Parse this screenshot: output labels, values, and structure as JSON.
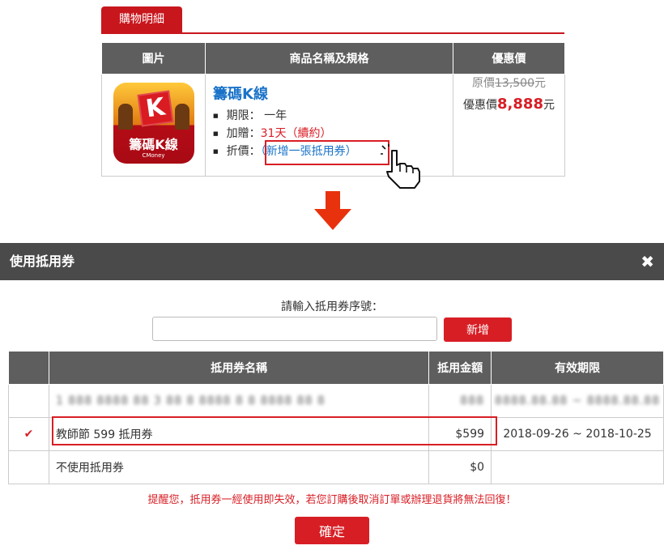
{
  "cart": {
    "tab_label": "購物明細",
    "headers": {
      "image": "圖片",
      "name": "商品名稱及規格",
      "price": "優惠價"
    },
    "product": {
      "icon_name": "籌碼K線",
      "icon_letter": "K",
      "icon_brand": "CMoney",
      "name": "籌碼K線",
      "spec_period_label": "期限：",
      "spec_period_value": "一年",
      "spec_bonus_label": "加贈：",
      "spec_bonus_value": "31天",
      "spec_bonus_link": "（續約）",
      "spec_discount_label": "折價：",
      "spec_discount_link": "（新增一張抵用券）",
      "orig_label": "原價",
      "orig_value": "13,500",
      "orig_unit": "元",
      "sale_label": "優惠價",
      "sale_value": "8,888",
      "sale_unit": "元"
    }
  },
  "modal": {
    "title": "使用抵用券",
    "close_icon": "close-icon",
    "prompt": "請輸入抵用券序號：",
    "input_value": "",
    "input_placeholder": "",
    "add_label": "新增",
    "table_headers": {
      "check": "",
      "name": "抵用券名稱",
      "amount": "抵用金額",
      "expiry": "有效期限"
    },
    "rows": [
      {
        "checked": "",
        "name": "1 888 8888 88 3 88 8 8888 8 8 8888 88 8",
        "amount": "888",
        "expiry": "8888.88.88 ~ 8888.88.88"
      },
      {
        "checked": "✔",
        "name": "教師節 599 抵用券",
        "amount": "$599",
        "expiry": "2018-09-26 ~ 2018-10-25"
      },
      {
        "checked": "",
        "name": "不使用抵用券",
        "amount": "$0",
        "expiry": ""
      }
    ],
    "notice": "提醒您，抵用券一經使用即失效，若您訂購後取消訂單或辦理退貨將無法回復！",
    "confirm_label": "確定"
  },
  "colors": {
    "accent": "#d81e25",
    "header_gray": "#5e5e5e",
    "modal_header": "#4a4a4a",
    "link_blue": "#1a73c9"
  }
}
